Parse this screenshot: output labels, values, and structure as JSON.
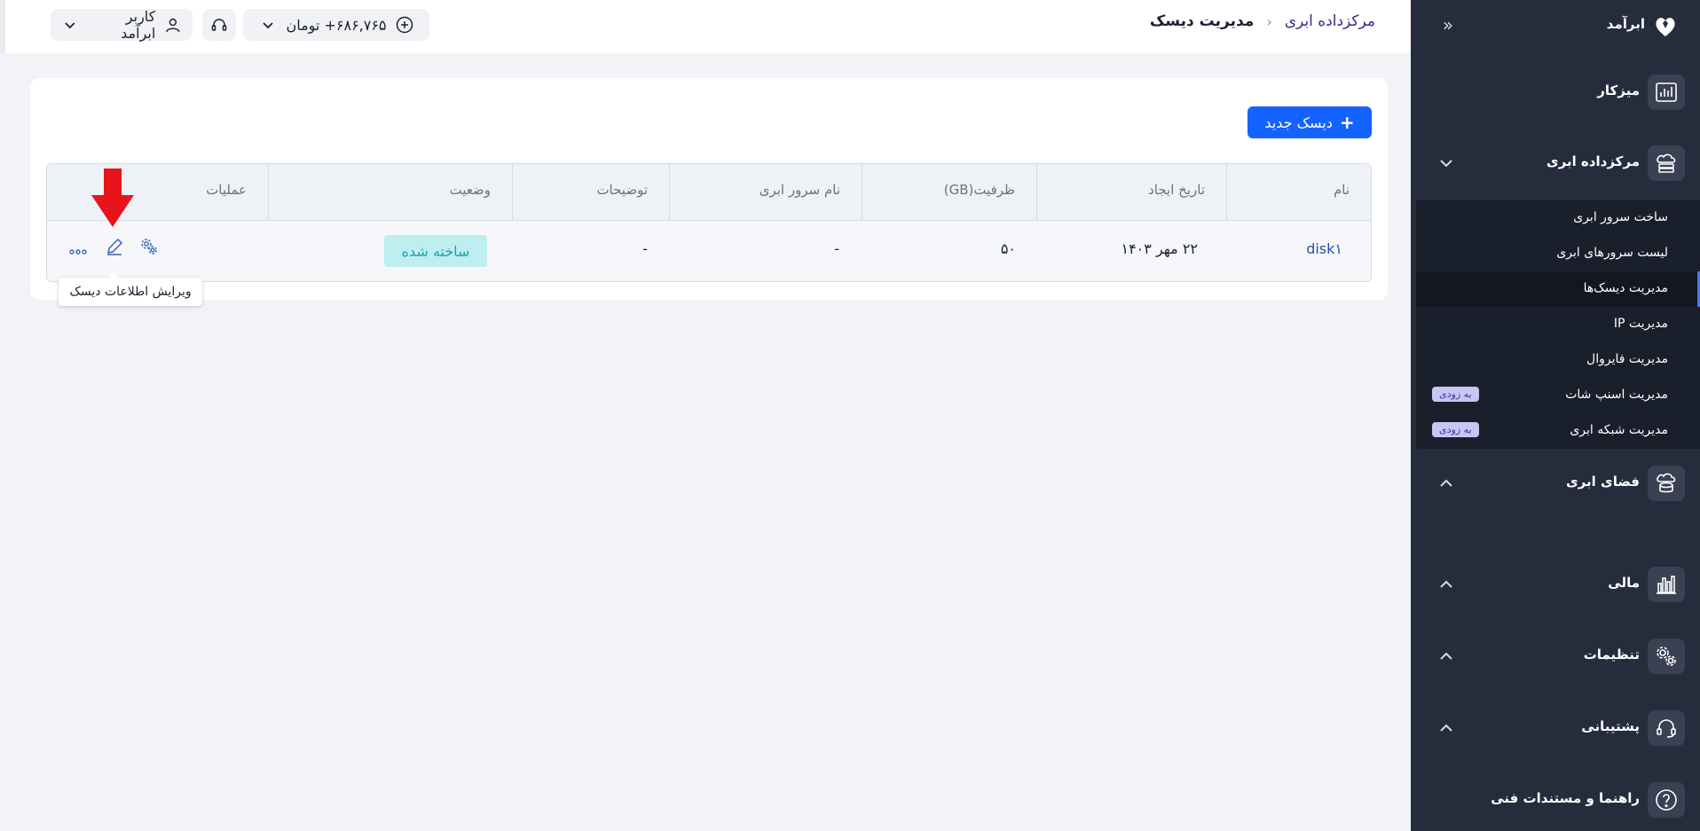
{
  "sidebar": {
    "brand": "ابرآمد",
    "nav": [
      {
        "label": "میزکار",
        "icon": "dashboard-chart-icon"
      },
      {
        "label": "مرکزداده ابری",
        "icon": "cloud-server-icon"
      },
      {
        "label": "فضای ابری",
        "icon": "cloud-storage-icon"
      },
      {
        "label": "مالی",
        "icon": "finance-chart-icon"
      },
      {
        "label": "تنظیمات",
        "icon": "settings-gears-icon"
      },
      {
        "label": "پشتیبانی",
        "icon": "headset-icon"
      },
      {
        "label": "راهنما و مستندات فنی",
        "icon": "help-icon"
      }
    ],
    "submenu": [
      {
        "label": "ساخت سرور ابری"
      },
      {
        "label": "لیست سرورهای ابری"
      },
      {
        "label": "مدیریت دیسک‌ها",
        "active": true
      },
      {
        "label": "مدیریت IP"
      },
      {
        "label": "مدیریت فایروال"
      },
      {
        "label": "مدیریت اسنپ شات",
        "badge": "به زودی"
      },
      {
        "label": "مدیریت شبکه ابری",
        "badge": "به زودی"
      }
    ]
  },
  "header": {
    "breadcrumb_parent": "مرکزداده ابری",
    "breadcrumb_current": "مدیریت دیسک",
    "balance": "۶۸۶,۷۶۵+ تومان",
    "user": "کاربر ابرآمد"
  },
  "main": {
    "new_disk_label": "دیسک جدید",
    "columns": [
      "نام",
      "تاریخ ایجاد",
      "ظرفیت(GB)",
      "نام سرور ابری",
      "توضیحات",
      "وضعیت",
      "عملیات"
    ],
    "rows": [
      {
        "name": "disk۱",
        "created": "۲۲ مهر ۱۴۰۳",
        "capacity": "۵۰",
        "server": "-",
        "description": "-",
        "status": "ساخته شده"
      }
    ],
    "tooltip": "ویرایش اطلاعات دیسک"
  },
  "colors": {
    "sidebar_bg": "#252c3c",
    "accent": "#1563ff",
    "status_bg": "#bfeef0",
    "status_text": "#1aa3ab",
    "annotation_arrow": "#e8141c"
  }
}
